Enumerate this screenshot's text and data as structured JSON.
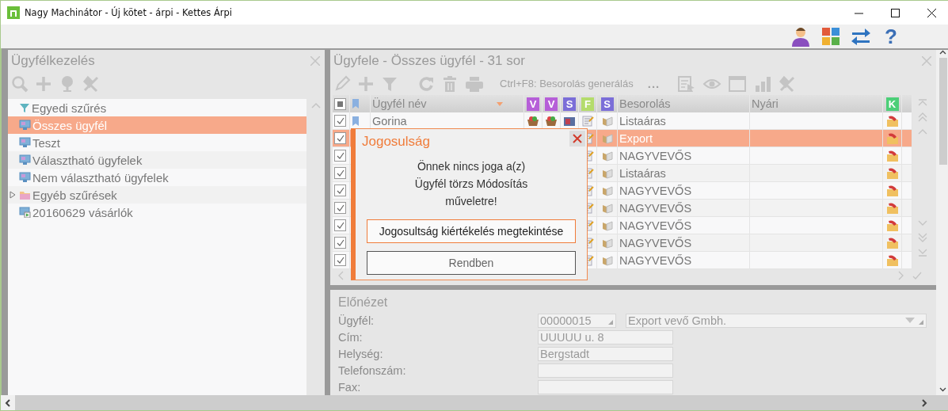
{
  "window": {
    "title": "Nagy Machinátor - Új kötet - árpi - Kettes Árpi"
  },
  "top_toolbar": {
    "help": "?"
  },
  "left_panel": {
    "title": "Ügyfélkezelés",
    "items": [
      {
        "label": "Egyedi szűrés",
        "kind": "filter",
        "selected": false
      },
      {
        "label": "Összes ügyfél",
        "kind": "view",
        "selected": true
      },
      {
        "label": "Teszt",
        "kind": "view",
        "selected": false
      },
      {
        "label": "Választható ügyfelek",
        "kind": "view",
        "selected": false
      },
      {
        "label": "Nem választható ügyfelek",
        "kind": "view",
        "selected": false
      },
      {
        "label": "Egyéb szűrések",
        "kind": "folder",
        "selected": false,
        "expanded": false
      },
      {
        "label": "20160629 vásárlók",
        "kind": "saved",
        "selected": false
      }
    ]
  },
  "right_panel": {
    "title": "Ügyfele - Összes ügyfél - 31 sor",
    "toolbar_hint": "Ctrl+F8: Besorolás generálás",
    "toolbar_more": "...",
    "table": {
      "header_checkbox_partial": true,
      "columns": [
        {
          "label": "Ügyfél név",
          "kind": "text"
        },
        {
          "label": "V",
          "kind": "badge",
          "color": "#b65fd8"
        },
        {
          "label": "V",
          "kind": "badge",
          "color": "#b65fd8"
        },
        {
          "label": "S",
          "kind": "badge",
          "color": "#7b6ed8"
        },
        {
          "label": "F",
          "kind": "badge",
          "color": "#b4dc6c"
        },
        {
          "label": "S",
          "kind": "badge",
          "color": "#7b6ed8"
        },
        {
          "label": "Besorolás",
          "kind": "text"
        },
        {
          "label": "Nyári",
          "kind": "text"
        },
        {
          "label": "K",
          "kind": "badge",
          "color": "#4ccf78"
        }
      ],
      "rows": [
        {
          "checked": true,
          "selected": false,
          "name": "Gorina",
          "category": "Listaáras"
        },
        {
          "checked": true,
          "selected": true,
          "category": "Export"
        },
        {
          "checked": true,
          "selected": false,
          "category": "NAGYVEVŐS"
        },
        {
          "checked": true,
          "selected": false,
          "category": "Listaáras"
        },
        {
          "checked": true,
          "selected": false,
          "category": "NAGYVEVŐS"
        },
        {
          "checked": true,
          "selected": false,
          "category": "NAGYVEVŐS"
        },
        {
          "checked": true,
          "selected": false,
          "category": "NAGYVEVŐS"
        },
        {
          "checked": true,
          "selected": false,
          "category": "NAGYVEVŐS"
        },
        {
          "checked": true,
          "selected": false,
          "category": "NAGYVEVŐS"
        }
      ]
    }
  },
  "dialog": {
    "title": "Jogosulság",
    "message": "Önnek nincs joga a(z)\nÜgyfél törzs Módosítás\nműveletre!",
    "buttons": [
      {
        "label": "Jogosultság kiértékelés megtekintése",
        "focused": true
      },
      {
        "label": "Rendben",
        "focused": false
      }
    ]
  },
  "preview": {
    "title": "Előnézet",
    "fields": [
      {
        "label": "Ügyfél:",
        "kind": "lookup",
        "code": "00000015",
        "value": "Export vevő Gmbh."
      },
      {
        "label": "Cím:",
        "kind": "text",
        "value": "UUUUU u. 8"
      },
      {
        "label": "Helység:",
        "kind": "text",
        "value": "Bergstadt"
      },
      {
        "label": "Telefonszám:",
        "kind": "text"
      },
      {
        "label": "Fax:",
        "kind": "text"
      }
    ]
  }
}
